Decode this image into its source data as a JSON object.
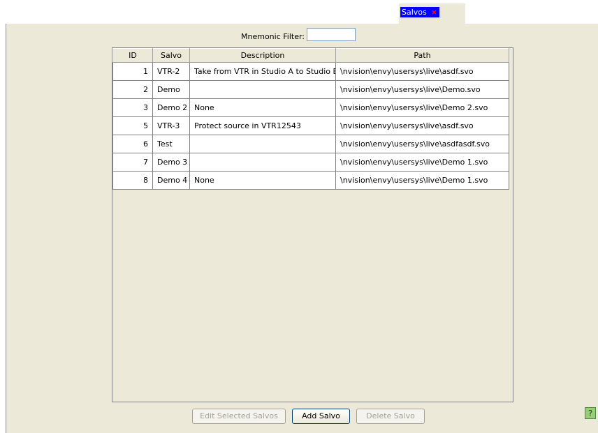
{
  "tab": {
    "label": "Salvos",
    "close": "×"
  },
  "filter": {
    "label": "Mnemonic Filter:",
    "value": ""
  },
  "table": {
    "columns": [
      "ID",
      "Salvo",
      "Description",
      "Path"
    ],
    "rows": [
      [
        "1",
        "VTR-2",
        "Take from VTR in Studio A to Studio B",
        "\\nvision\\envy\\usersys\\live\\asdf.svo"
      ],
      [
        "2",
        "Demo",
        "",
        "\\nvision\\envy\\usersys\\live\\Demo.svo"
      ],
      [
        "3",
        "Demo 2",
        "None",
        "\\nvision\\envy\\usersys\\live\\Demo 2.svo"
      ],
      [
        "5",
        "VTR-3",
        "Protect source in VTR12543",
        "\\nvision\\envy\\usersys\\live\\asdf.svo"
      ],
      [
        "6",
        "Test",
        "",
        "\\nvision\\envy\\usersys\\live\\asdfasdf.svo"
      ],
      [
        "7",
        "Demo 3",
        "",
        "\\nvision\\envy\\usersys\\live\\Demo 1.svo"
      ],
      [
        "8",
        "Demo 4",
        "None",
        "\\nvision\\envy\\usersys\\live\\Demo 1.svo"
      ]
    ]
  },
  "buttons": {
    "edit": "Edit Selected Salvos",
    "add": "Add Salvo",
    "delete": "Delete Salvo"
  },
  "help": {
    "icon": "question-mark",
    "glyph": "?"
  }
}
